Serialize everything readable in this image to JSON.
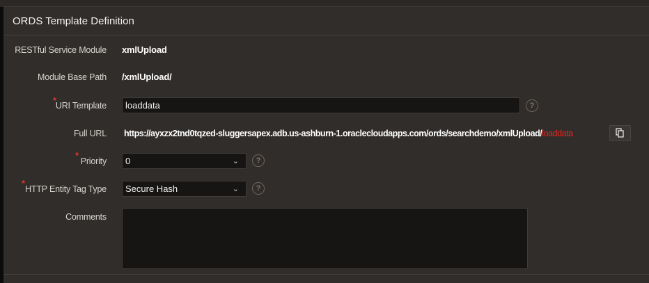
{
  "region": {
    "title": "ORDS Template Definition"
  },
  "fields": {
    "module": {
      "label": "RESTful Service Module",
      "value": "xmlUpload"
    },
    "base_path": {
      "label": "Module Base Path",
      "value": "/xmlUpload/"
    },
    "uri_template": {
      "label": "URI Template",
      "value": "loaddata",
      "required": "*"
    },
    "full_url": {
      "label": "Full URL",
      "prefix": "https://ayxzx2tnd0tqzed-sluggersapex.adb.us-ashburn-1.oraclecloudapps.com/ords/searchdemo/xmlUpload/",
      "suffix": "loaddata"
    },
    "priority": {
      "label": "Priority",
      "value": "0",
      "required": "*"
    },
    "etag": {
      "label": "HTTP Entity Tag Type",
      "value": "Secure Hash",
      "required": "*"
    },
    "comments": {
      "label": "Comments",
      "value": ""
    }
  },
  "help_glyph": "?",
  "colors": {
    "required": "#d9372b",
    "url_suffix": "#e5281f"
  }
}
